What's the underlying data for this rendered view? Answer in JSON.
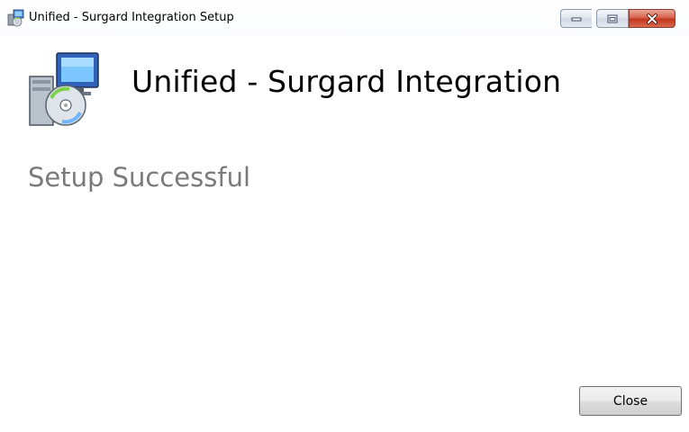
{
  "window": {
    "title": "Unified - Surgard Integration Setup",
    "icon": "setup-installer-icon"
  },
  "caption_buttons": {
    "minimize_icon": "minimize-icon",
    "maximize_icon": "maximize-icon",
    "close_icon": "close-icon"
  },
  "header": {
    "title": "Unified - Surgard Integration",
    "icon": "setup-installer-icon"
  },
  "status": {
    "text": "Setup Successful"
  },
  "footer": {
    "close_label": "Close"
  },
  "colors": {
    "status_text": "#7a7a7a",
    "close_caption_red": "#c2361c",
    "background": "#ffffff"
  }
}
